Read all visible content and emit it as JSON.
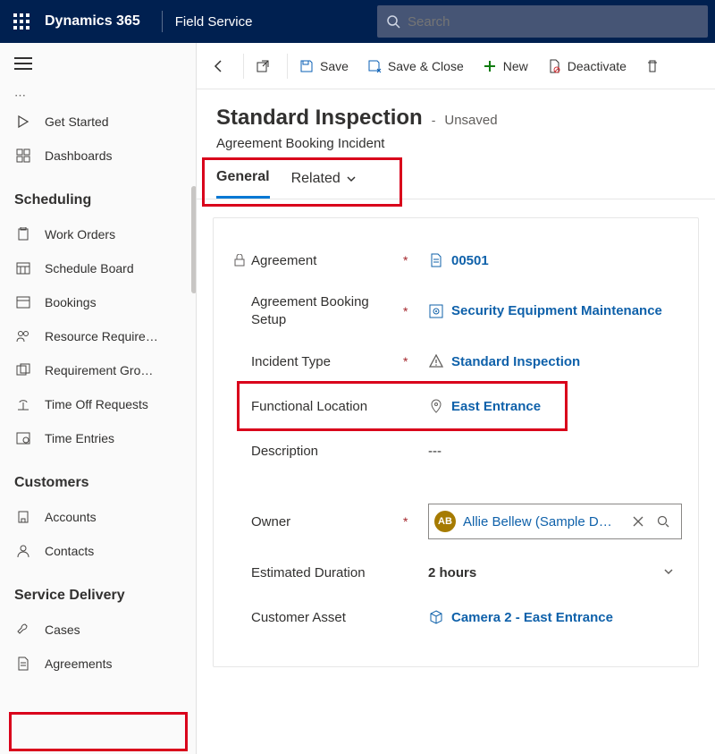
{
  "header": {
    "brand": "Dynamics 365",
    "module": "Field Service",
    "search_placeholder": "Search"
  },
  "nav": {
    "truncated_label": "…",
    "items1": [
      {
        "label": "Get Started"
      },
      {
        "label": "Dashboards"
      }
    ],
    "heading_scheduling": "Scheduling",
    "scheduling_items": [
      {
        "label": "Work Orders"
      },
      {
        "label": "Schedule Board"
      },
      {
        "label": "Bookings"
      },
      {
        "label": "Resource Require…"
      },
      {
        "label": "Requirement Gro…"
      },
      {
        "label": "Time Off Requests"
      },
      {
        "label": "Time Entries"
      }
    ],
    "heading_customers": "Customers",
    "customer_items": [
      {
        "label": "Accounts"
      },
      {
        "label": "Contacts"
      }
    ],
    "heading_service_delivery": "Service Delivery",
    "sd_items": [
      {
        "label": "Cases"
      },
      {
        "label": "Agreements"
      }
    ]
  },
  "commands": {
    "save": "Save",
    "save_close": "Save & Close",
    "new": "New",
    "deactivate": "Deactivate"
  },
  "record": {
    "title": "Standard Inspection",
    "dash": "-",
    "status": "Unsaved",
    "subtitle": "Agreement Booking Incident"
  },
  "tabs": {
    "general": "General",
    "related": "Related"
  },
  "form": {
    "agreement": {
      "label": "Agreement",
      "value": "00501"
    },
    "booking_setup": {
      "label": "Agreement Booking Setup",
      "value": "Security Equipment Maintenance"
    },
    "incident_type": {
      "label": "Incident Type",
      "value": "Standard Inspection"
    },
    "functional_location": {
      "label": "Functional Location",
      "value": "East Entrance"
    },
    "description": {
      "label": "Description",
      "value": "---"
    },
    "owner": {
      "label": "Owner",
      "initials": "AB",
      "value": "Allie Bellew (Sample D…"
    },
    "estimated_duration": {
      "label": "Estimated Duration",
      "value": "2 hours"
    },
    "customer_asset": {
      "label": "Customer Asset",
      "value": "Camera 2 - East Entrance"
    }
  }
}
